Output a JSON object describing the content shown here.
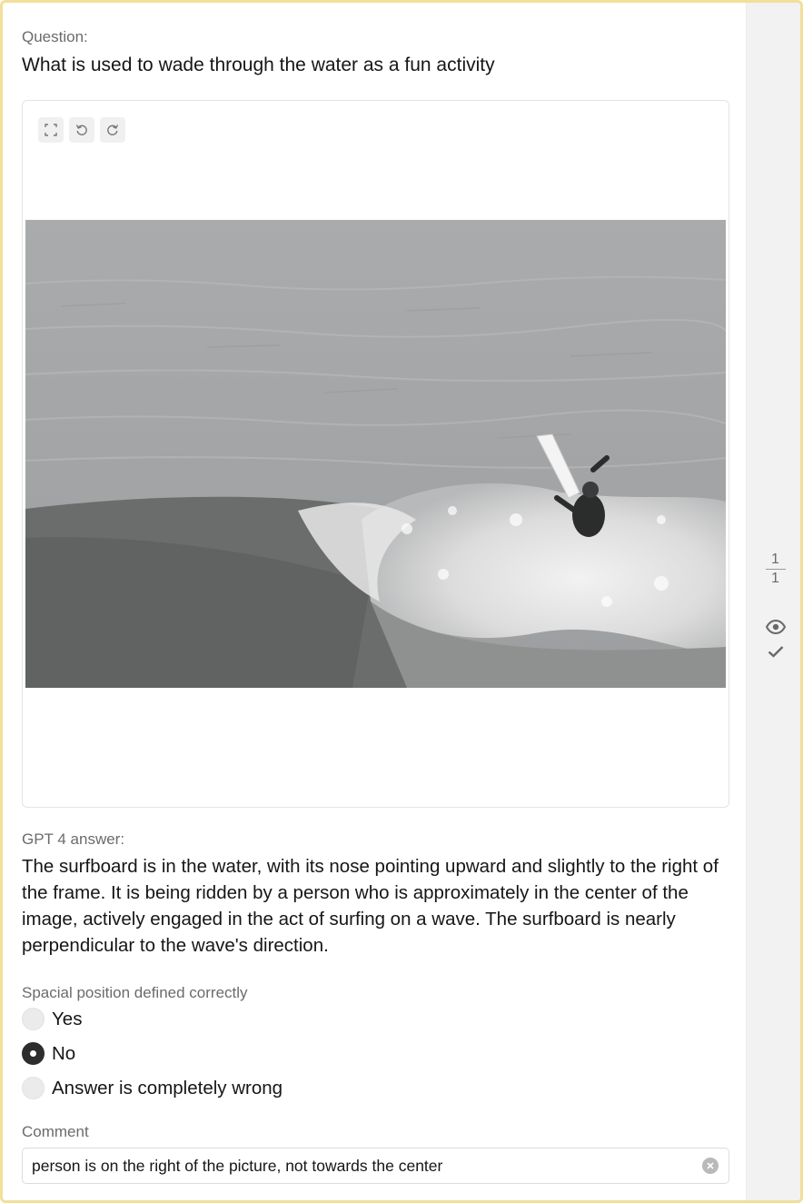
{
  "question": {
    "label": "Question:",
    "text": "What is used to wade through the water as a fun activity"
  },
  "image_viewer": {
    "tools": [
      {
        "icon": "fit-screen-icon"
      },
      {
        "icon": "rotate-left-icon"
      },
      {
        "icon": "rotate-right-icon"
      }
    ]
  },
  "answer": {
    "label": "GPT 4 answer:",
    "text": "The surfboard is in the water, with its nose pointing upward and slightly to the right of the frame. It is being ridden by a person who is approximately in the center of the image, actively engaged in the act of surfing on a wave. The surfboard is nearly perpendicular to the wave's direction."
  },
  "spatial_question": {
    "label": "Spacial position defined correctly",
    "options": [
      {
        "label": "Yes",
        "selected": false
      },
      {
        "label": "No",
        "selected": true
      },
      {
        "label": "Answer is completely wrong",
        "selected": false
      }
    ]
  },
  "comment": {
    "label": "Comment",
    "value": "person is on the right of the picture, not towards the center"
  },
  "sidebar": {
    "page_current": "1",
    "page_total": "1",
    "icons": [
      "eye-icon",
      "check-icon"
    ]
  }
}
